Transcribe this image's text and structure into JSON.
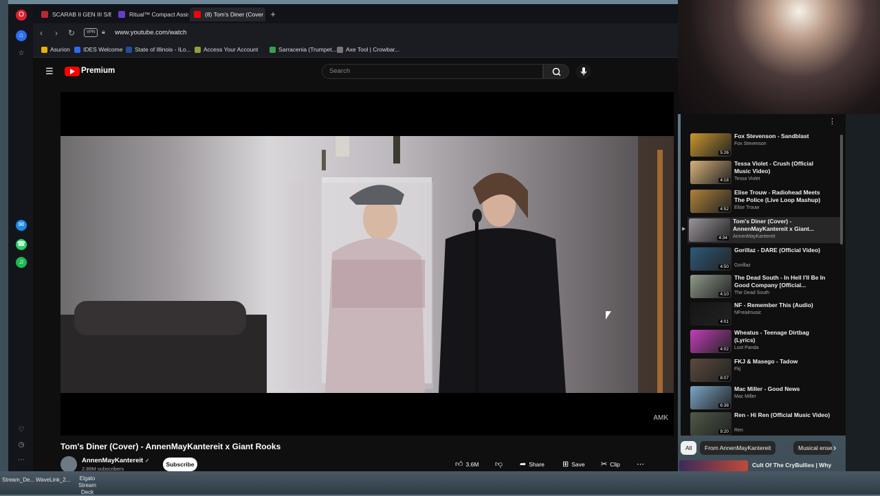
{
  "browser": {
    "tabs": [
      {
        "label": "SCARAB II GEN III S/E B",
        "color": "#c0262d"
      },
      {
        "label": "Ritual™ Compact Assist",
        "color": "#6a3bd1"
      },
      {
        "label": "(8) Tom's Diner (Cover",
        "color": "#ff0000"
      }
    ],
    "url": "www.youtube.com/watch",
    "vpn_label": "VPN",
    "bookmarks": [
      "Asurion",
      "IDES Welcome",
      "State of Illinois - ILo...",
      "Access Your Account",
      "Sarracenia (Trumpet...",
      "Axe Tool | Crowbar..."
    ]
  },
  "youtube": {
    "logo_text": "Premium",
    "search_placeholder": "Search",
    "video": {
      "title": "Tom's Diner (Cover) - AnnenMayKantereit x Giant Rooks",
      "watermark": "AMK",
      "channel": "AnnenMayKantereit",
      "subscribers": "2.89M subscribers",
      "subscribe_label": "Subscribe",
      "likes": "3.6M",
      "share_label": "Share",
      "save_label": "Save",
      "clip_label": "Clip"
    },
    "recommendations": [
      {
        "title": "Fox Stevenson - Sandblast",
        "channel": "Fox Stevenson",
        "duration": "5:26",
        "thumb": "#c8962e"
      },
      {
        "title": "Tessa Violet - Crush (Official Music Video)",
        "channel": "Tessa Violet",
        "duration": "4:18",
        "thumb": "#d8b27a"
      },
      {
        "title": "Elise Trouw - Radiohead Meets The Police (Live Loop Mashup)",
        "channel": "Elise Trouw",
        "duration": "4:52",
        "thumb": "#b0823a"
      },
      {
        "title": "Tom's Diner (Cover) - AnnenMayKantereit x Giant...",
        "channel": "AnnenMayKantereit",
        "duration": "4:34",
        "thumb": "#9a949a"
      },
      {
        "title": "Gorillaz - DARE (Official Video)",
        "channel": "Gorillaz",
        "duration": "4:50",
        "thumb": "#2d5a7a"
      },
      {
        "title": "The Dead South - In Hell I'll Be In Good Company [Official...",
        "channel": "The Dead South",
        "duration": "4:10",
        "thumb": "#8e9a8a"
      },
      {
        "title": "NF - Remember This (Audio)",
        "channel": "NFrealmusic",
        "duration": "4:01",
        "thumb": "#151515"
      },
      {
        "title": "Wheatus - Teenage Dirtbag (Lyrics)",
        "channel": "Lost Panda",
        "duration": "4:02",
        "thumb": "#c23fb8"
      },
      {
        "title": "FKJ & Masego - Tadow",
        "channel": "Fkj",
        "duration": "8:07",
        "thumb": "#5a4a3e"
      },
      {
        "title": "Mac Miller - Good News",
        "channel": "Mac Miller",
        "duration": "6:38",
        "thumb": "#7aa6c8"
      },
      {
        "title": "Ren - Hi Ren (Official Music Video)",
        "channel": "Ren",
        "duration": "9:20",
        "thumb": "#4e5a48"
      }
    ],
    "chips": [
      "All",
      "From AnnenMayKantereit",
      "Musical ensem"
    ],
    "next_rec_title": "Cult Of The CryBullies | Why"
  },
  "taskbar": {
    "items": [
      "Stream_De...",
      "WaveLink_2...",
      "Elgato Stream Deck"
    ]
  }
}
